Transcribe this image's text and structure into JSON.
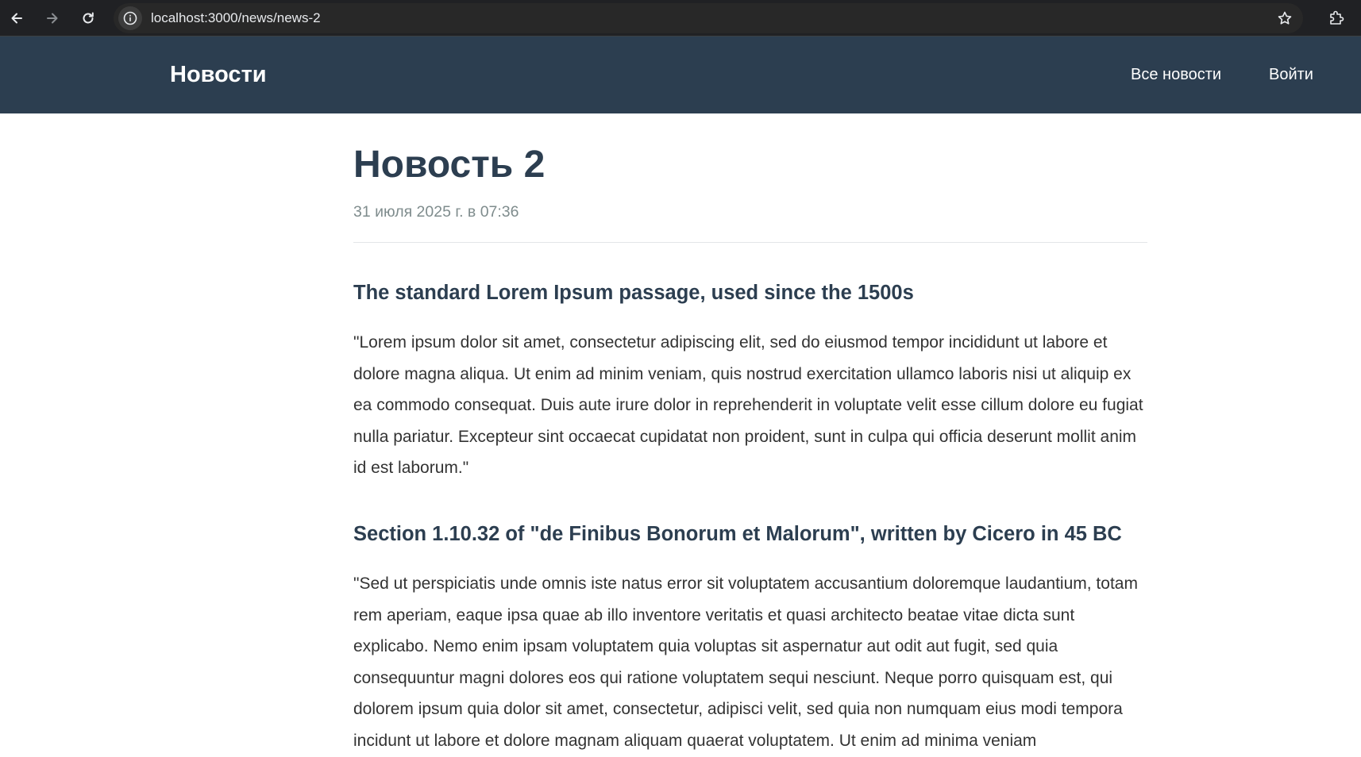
{
  "browser": {
    "url": "localhost:3000/news/news-2",
    "icons": {
      "back": "arrow-left-icon",
      "forward": "arrow-right-icon",
      "reload": "reload-icon",
      "site_info": "info-icon",
      "bookmark": "star-icon",
      "extensions": "extensions-icon"
    }
  },
  "header": {
    "logo": "Новости",
    "nav": {
      "all_news": "Все новости",
      "login": "Войти"
    },
    "colors": {
      "background": "#2c3e50",
      "text": "#ffffff"
    }
  },
  "article": {
    "title": "Новость 2",
    "date": "31 июля 2025 г. в 07:36",
    "sections": [
      {
        "heading": "The standard Lorem Ipsum passage, used since the 1500s",
        "text": "\"Lorem ipsum dolor sit amet, consectetur adipiscing elit, sed do eiusmod tempor incididunt ut labore et dolore magna aliqua. Ut enim ad minim veniam, quis nostrud exercitation ullamco laboris nisi ut aliquip ex ea commodo consequat. Duis aute irure dolor in reprehenderit in voluptate velit esse cillum dolore eu fugiat nulla pariatur. Excepteur sint occaecat cupidatat non proident, sunt in culpa qui officia deserunt mollit anim id est laborum.\""
      },
      {
        "heading": "Section 1.10.32 of \"de Finibus Bonorum et Malorum\", written by Cicero in 45 BC",
        "text": "\"Sed ut perspiciatis unde omnis iste natus error sit voluptatem accusantium doloremque laudantium, totam rem aperiam, eaque ipsa quae ab illo inventore veritatis et quasi architecto beatae vitae dicta sunt explicabo. Nemo enim ipsam voluptatem quia voluptas sit aspernatur aut odit aut fugit, sed quia consequuntur magni dolores eos qui ratione voluptatem sequi nesciunt. Neque porro quisquam est, qui dolorem ipsum quia dolor sit amet, consectetur, adipisci velit, sed quia non numquam eius modi tempora incidunt ut labore et dolore magnam aliquam quaerat voluptatem. Ut enim ad minima veniam"
      }
    ],
    "colors": {
      "title": "#2c3e50",
      "date": "#7f8c8d",
      "body": "#333333"
    }
  }
}
